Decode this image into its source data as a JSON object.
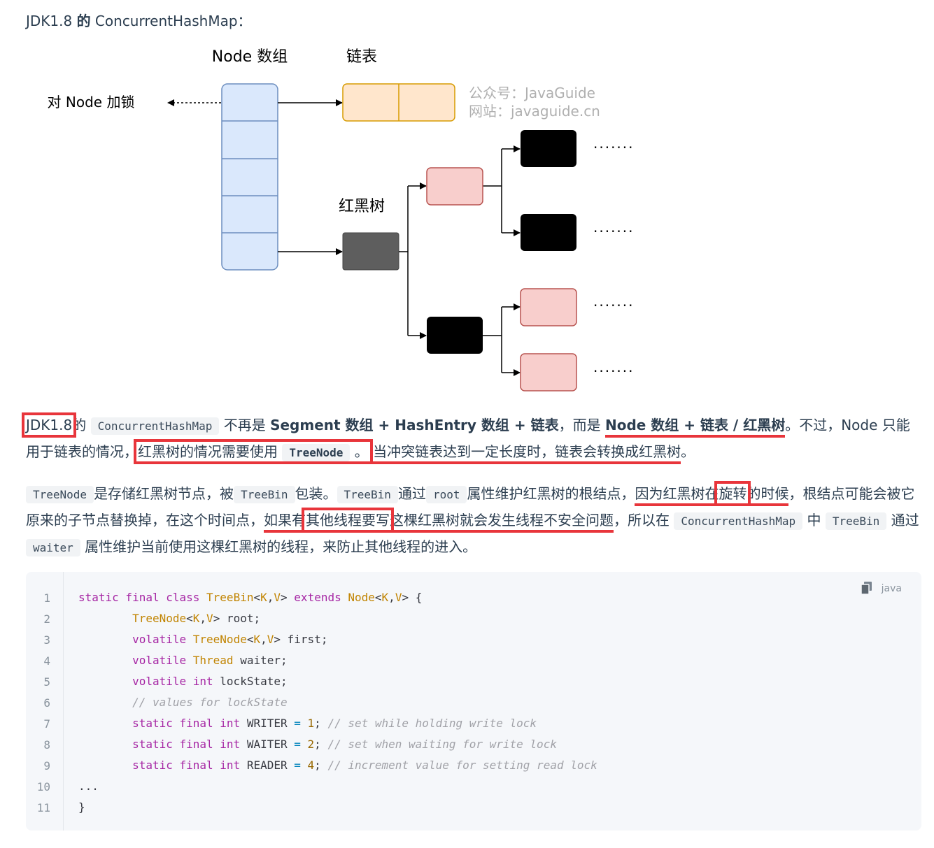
{
  "heading": {
    "prefix": "JDK1.8 ",
    "bold": "的",
    "suffix": " ConcurrentHashMap："
  },
  "diagram": {
    "node_array_label": "Node 数组",
    "linked_list_label": "链表",
    "lock_label": "对 Node 加锁",
    "rbtree_label": "红黑树",
    "watermark_1": "公众号：JavaGuide",
    "watermark_2": "网站：javaguide.cn",
    "dots": "·······",
    "colors": {
      "array_fill": "#dae8fc",
      "array_stroke": "#6c8ebf",
      "list_fill": "#ffe6cc",
      "list_stroke": "#d79b00",
      "red_fill": "#f8cecc",
      "red_stroke": "#b85450",
      "black": "#000000",
      "gray": "#5e5e5e"
    }
  },
  "para1": {
    "t1": "JDK1.8",
    "t2": "的",
    "code1": "ConcurrentHashMap",
    "t3": "不再是 ",
    "b1": "Segment 数组 + HashEntry 数组 + 链表",
    "t4": "，而是 ",
    "b2": "Node 数组 + 链表 / 红黑树",
    "t5": "。不过，Node 只能用于链表的情况，",
    "t6": "红黑树的情况需要使用",
    "code2": "TreeNode",
    "t7": "。",
    "t8": "当冲突链表达到一定长度时，链表会转换成红黑树",
    "t9": "。"
  },
  "para2": {
    "code1": "TreeNode",
    "t1": "是存储红黑树节点，被",
    "code2": "TreeBin",
    "t2": "包装。",
    "code3": "TreeBin",
    "t3": "通过",
    "code4": "root",
    "t4": "属性维护红黑树的根结点，",
    "t5a": "因为红黑树在",
    "t5b": "旋转",
    "t5c": "的时候",
    "t6": "，根结点可能会被它原来的子节点替换掉，在这个时间点，",
    "t7a": "如果有",
    "t7b": "其他线程要写",
    "t7c": "这棵红黑树就会发生线程不安全问题",
    "t8": "，所以在",
    "code5": "ConcurrentHashMap",
    "t9": "中",
    "code6": "TreeBin",
    "t10": "通过",
    "code7": "waiter",
    "t11": "属性维护当前使用这棵红黑树的线程，来防止其他线程的进入。"
  },
  "code": {
    "lang": "java",
    "line_numbers": [
      "1",
      "2",
      "3",
      "4",
      "5",
      "6",
      "7",
      "8",
      "9",
      "10",
      "11"
    ],
    "lines": [
      [
        [
          "kw",
          "static final class "
        ],
        [
          "ty",
          "TreeBin"
        ],
        [
          "",
          "<"
        ],
        [
          "ty",
          "K"
        ],
        [
          "",
          ","
        ],
        [
          "ty",
          "V"
        ],
        [
          "",
          "> "
        ],
        [
          "kw",
          "extends "
        ],
        [
          "ty",
          "Node"
        ],
        [
          "",
          "<"
        ],
        [
          "ty",
          "K"
        ],
        [
          "",
          ","
        ],
        [
          "ty",
          "V"
        ],
        [
          "",
          "> {"
        ]
      ],
      [
        [
          "",
          "        "
        ],
        [
          "ty",
          "TreeNode"
        ],
        [
          "",
          "<"
        ],
        [
          "ty",
          "K"
        ],
        [
          "",
          ","
        ],
        [
          "ty",
          "V"
        ],
        [
          "",
          "> root;"
        ]
      ],
      [
        [
          "",
          "        "
        ],
        [
          "kw",
          "volatile "
        ],
        [
          "ty",
          "TreeNode"
        ],
        [
          "",
          "<"
        ],
        [
          "ty",
          "K"
        ],
        [
          "",
          ","
        ],
        [
          "ty",
          "V"
        ],
        [
          "",
          "> first;"
        ]
      ],
      [
        [
          "",
          "        "
        ],
        [
          "kw",
          "volatile "
        ],
        [
          "ty",
          "Thread"
        ],
        [
          "",
          " waiter;"
        ]
      ],
      [
        [
          "",
          "        "
        ],
        [
          "kw",
          "volatile int"
        ],
        [
          "",
          " lockState;"
        ]
      ],
      [
        [
          "",
          "        "
        ],
        [
          "cm",
          "// values for lockState"
        ]
      ],
      [
        [
          "",
          "        "
        ],
        [
          "kw",
          "static final int"
        ],
        [
          "",
          " WRITER "
        ],
        [
          "op",
          "="
        ],
        [
          "",
          " "
        ],
        [
          "nu",
          "1"
        ],
        [
          "",
          "; "
        ],
        [
          "cm",
          "// set while holding write lock"
        ]
      ],
      [
        [
          "",
          "        "
        ],
        [
          "kw",
          "static final int"
        ],
        [
          "",
          " WAITER "
        ],
        [
          "op",
          "="
        ],
        [
          "",
          " "
        ],
        [
          "nu",
          "2"
        ],
        [
          "",
          "; "
        ],
        [
          "cm",
          "// set when waiting for write lock"
        ]
      ],
      [
        [
          "",
          "        "
        ],
        [
          "kw",
          "static final int"
        ],
        [
          "",
          " READER "
        ],
        [
          "op",
          "="
        ],
        [
          "",
          " "
        ],
        [
          "nu",
          "4"
        ],
        [
          "",
          "; "
        ],
        [
          "cm",
          "// increment value for setting read lock"
        ]
      ],
      [
        [
          "",
          "..."
        ]
      ],
      [
        [
          "",
          "}"
        ]
      ]
    ]
  }
}
